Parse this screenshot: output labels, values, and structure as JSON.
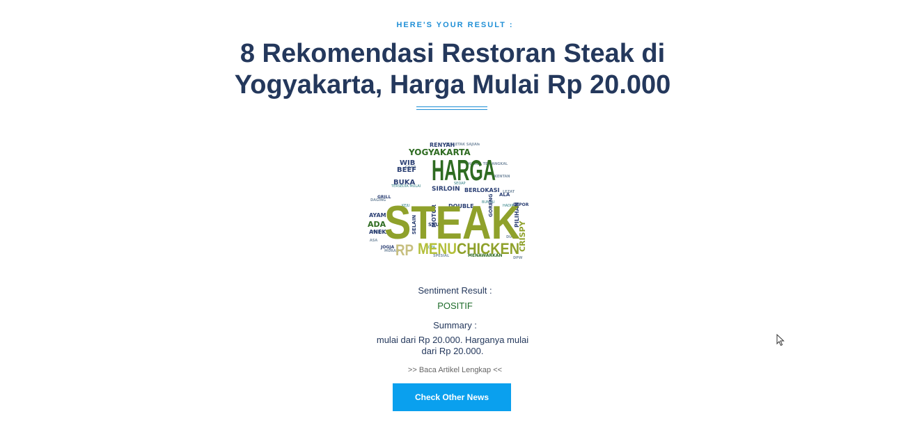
{
  "header": {
    "eyebrow": "HERE'S YOUR RESULT :",
    "title": "8 Rekomendasi Restoran Steak di Yogyakarta, Harga Mulai Rp 20.000"
  },
  "wordcloud": {
    "words": {
      "harga": "HARGA",
      "steak": "STEAK",
      "menu": "MENU",
      "chicken": "CHICKEN",
      "rp": "RP",
      "yogyakarta": "YOGYAKARTA",
      "beef": "BEEF",
      "wib": "WIB",
      "buka": "BUKA",
      "sirloin": "SIRLOIN",
      "berlokasi": "BERLOKASI",
      "double": "DOUBLE",
      "goreng": "GORENG",
      "pilihan": "PILIHAN",
      "crispy": "CRISPY",
      "motor": "MOTOR",
      "selain": "SELAIN",
      "saus": "SAUS",
      "ayam": "AYAM",
      "ada": "ADA",
      "aneka": "ANEKA",
      "jogja": "JOGJA",
      "renyah": "RENYAH",
      "impor": "IMPOR",
      "grill": "GRILL",
      "ala": "ALA",
      "menawarkan": "MENAWARKAN",
      "dpw": "DPW"
    },
    "colors": {
      "dark_green": "#2e6b21",
      "olive": "#8fa12b",
      "lime": "#b3bf3a",
      "tan": "#c7bf80",
      "navy": "#2b3f73",
      "teal": "#2f7f84",
      "slate": "#7f93a6"
    }
  },
  "sentiment": {
    "label": "Sentiment Result :",
    "value": "POSITIF",
    "value_color": "#1d6b2a"
  },
  "summary": {
    "label": "Summary :",
    "text": "mulai dari Rp 20.000. Harganya mulai dari Rp 20.000."
  },
  "links": {
    "read_more": ">> Baca Artikel Lengkap <<"
  },
  "button": {
    "label": "Check Other News",
    "color": "#0aa0ee"
  },
  "icons": {
    "cursor": "mouse-pointer-icon"
  }
}
